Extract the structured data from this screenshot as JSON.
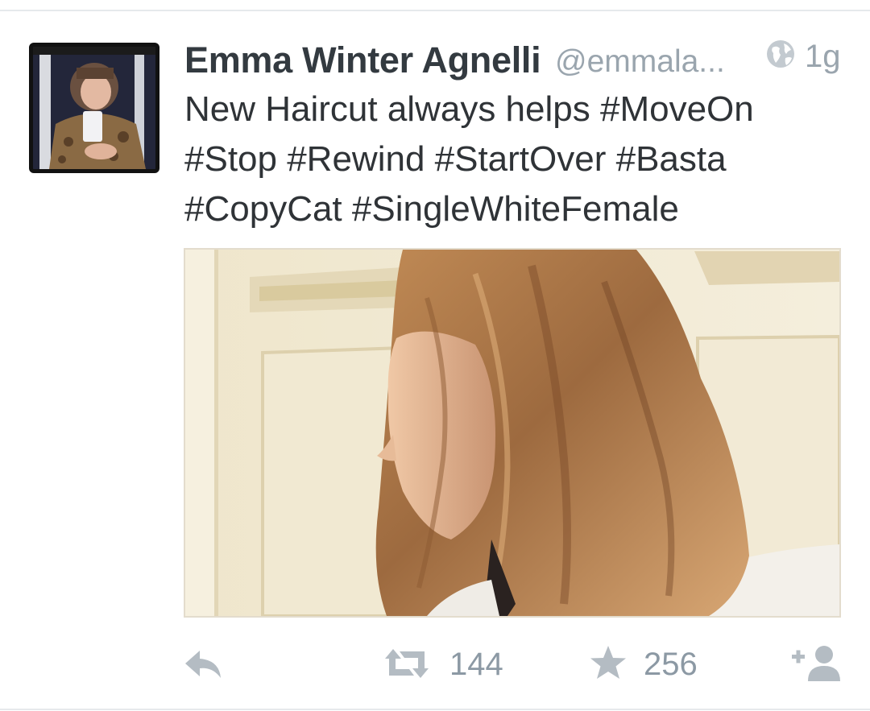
{
  "tweet": {
    "author_name": "Emma Winter Agnelli",
    "handle": "@emmala...",
    "timestamp": "1g",
    "text_lines": [
      "New Haircut always helps #MoveOn",
      "#Stop #Rewind #StartOver #Basta",
      "#CopyCat #SingleWhiteFemale"
    ],
    "privacy_icon": "globe-icon"
  },
  "actions": {
    "reply_icon": "reply-icon",
    "retweet_icon": "retweet-icon",
    "retweet_count": "144",
    "favorite_icon": "star-icon",
    "favorite_count": "256",
    "follow_icon": "add-user-icon"
  },
  "colors": {
    "text": "#2f3337",
    "secondary": "#9aa5ae",
    "action_icons": "#b4bcc3",
    "divider": "#e6e9ec"
  }
}
